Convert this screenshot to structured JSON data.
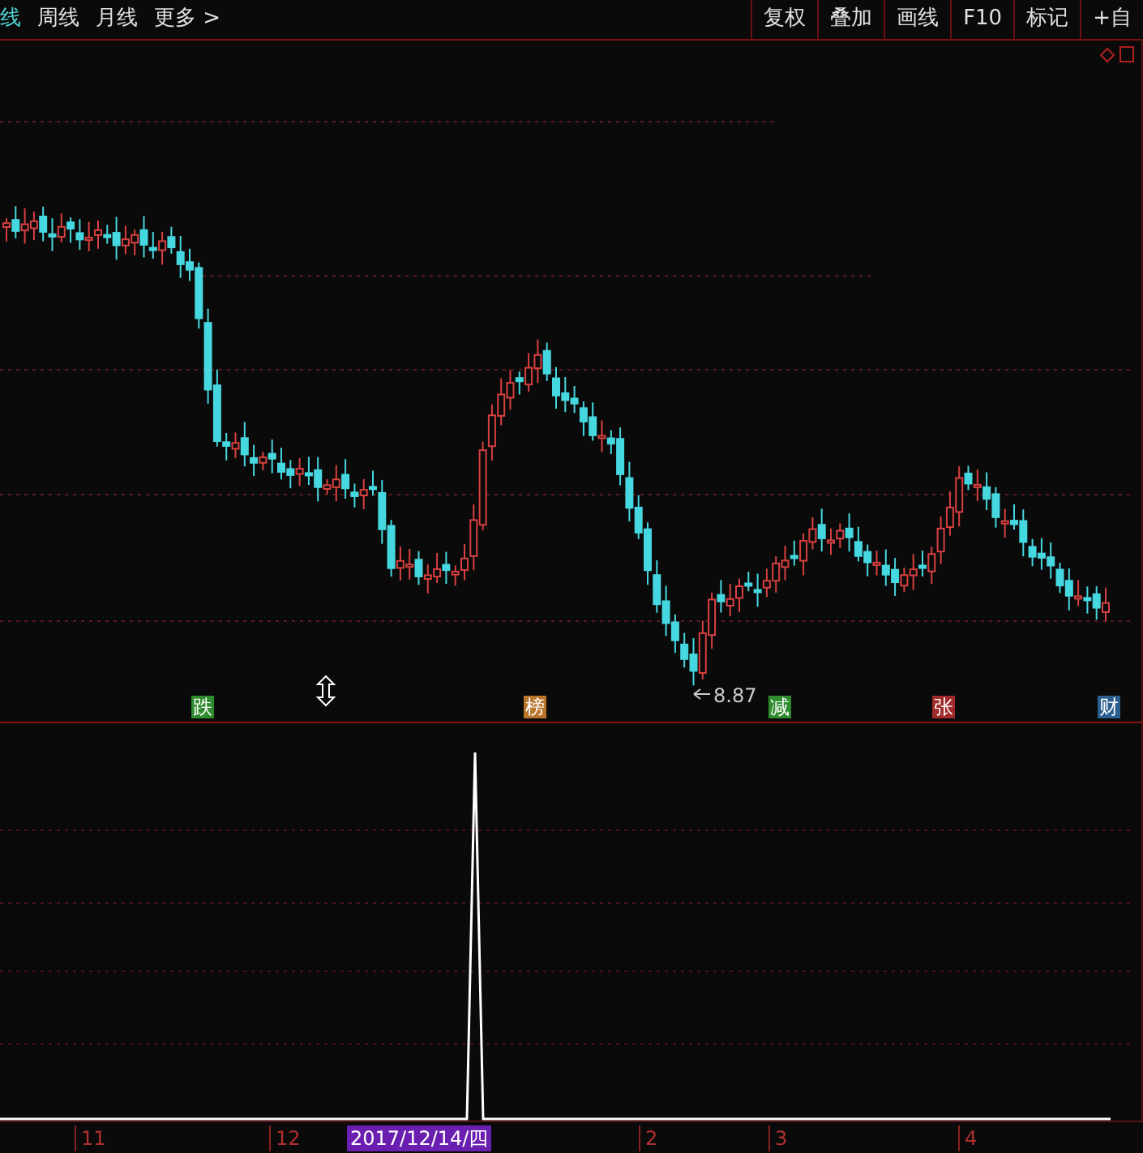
{
  "toolbar": {
    "tabs": [
      {
        "label": "线",
        "selected": true
      },
      {
        "label": "周线",
        "selected": false
      },
      {
        "label": "月线",
        "selected": false
      },
      {
        "label": "更多 >",
        "selected": false
      }
    ],
    "buttons": [
      "复权",
      "叠加",
      "画线",
      "F10",
      "标记",
      "+自"
    ]
  },
  "price_chart": {
    "low_label": "8.87",
    "event_markers": [
      {
        "label": "跌",
        "color": "#2e8b2e"
      },
      {
        "label": "榜",
        "color": "#b8742a"
      },
      {
        "label": "减",
        "color": "#2e8b2e"
      },
      {
        "label": "张",
        "color": "#a02a2a"
      },
      {
        "label": "财",
        "color": "#2a5f8f"
      }
    ]
  },
  "time_axis": {
    "labels": [
      {
        "label": "11",
        "selected": false
      },
      {
        "label": "12",
        "selected": false
      },
      {
        "label": "2017/12/14/四",
        "selected": true
      },
      {
        "label": "2",
        "selected": false
      },
      {
        "label": "3",
        "selected": false
      },
      {
        "label": "4",
        "selected": false
      }
    ]
  }
}
